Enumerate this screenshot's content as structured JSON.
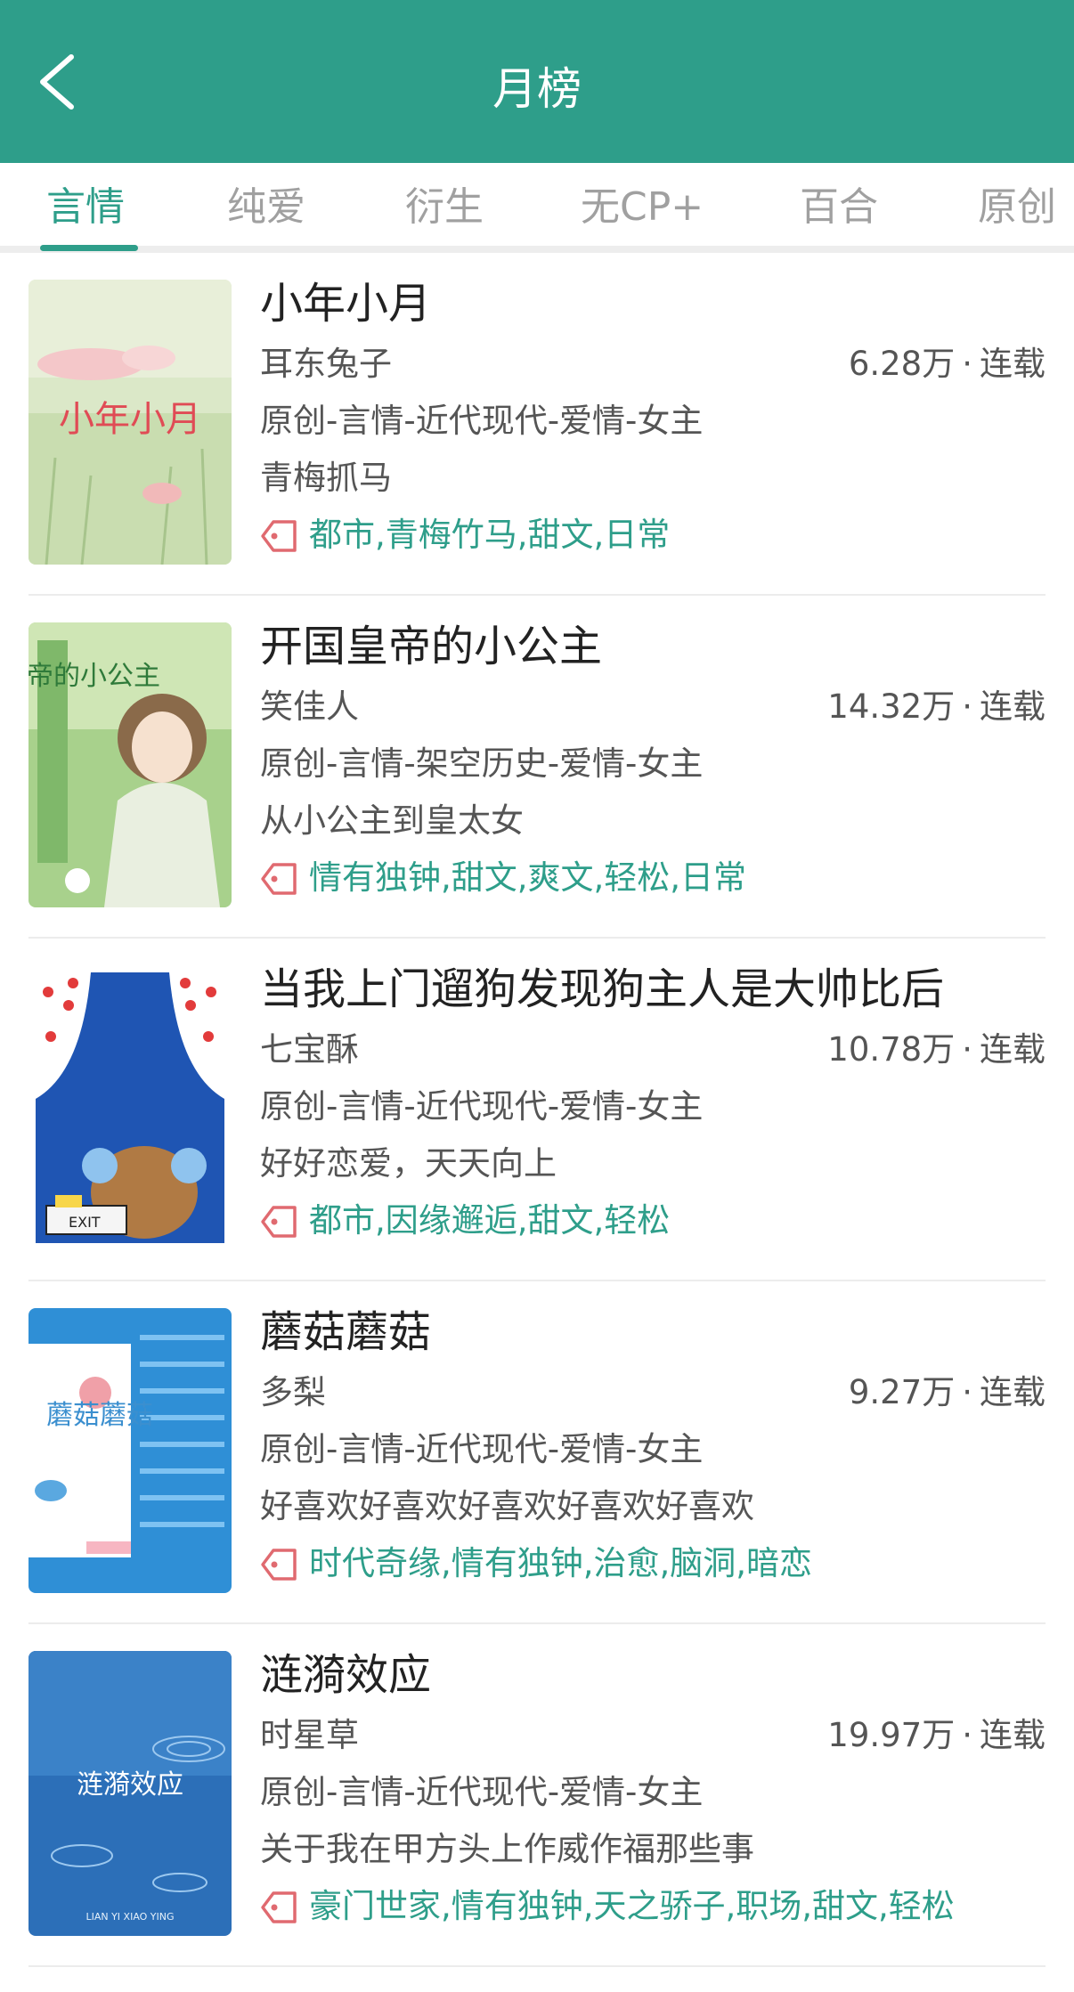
{
  "header": {
    "title": "月榜",
    "back_icon": "chevron-left-icon",
    "background": "#2e9e8a"
  },
  "tabs": [
    {
      "label": "言情",
      "active": true
    },
    {
      "label": "纯爱",
      "active": false
    },
    {
      "label": "衍生",
      "active": false
    },
    {
      "label": "无CP+",
      "active": false
    },
    {
      "label": "百合",
      "active": false
    },
    {
      "label": "原创",
      "active": false
    }
  ],
  "books": [
    {
      "title": "小年小月",
      "author": "耳东兔子",
      "count": "6.28万",
      "status": "连载",
      "category": "原创-言情-近代现代-爱情-女主",
      "intro": "青梅抓马",
      "tags": "都市,青梅竹马,甜文,日常"
    },
    {
      "title": "开国皇帝的小公主",
      "author": "笑佳人",
      "count": "14.32万",
      "status": "连载",
      "category": "原创-言情-架空历史-爱情-女主",
      "intro": "从小公主到皇太女",
      "tags": "情有独钟,甜文,爽文,轻松,日常"
    },
    {
      "title": "当我上门遛狗发现狗主人是大帅比后",
      "author": "七宝酥",
      "count": "10.78万",
      "status": "连载",
      "category": "原创-言情-近代现代-爱情-女主",
      "intro": "好好恋爱，天天向上",
      "tags": "都市,因缘邂逅,甜文,轻松"
    },
    {
      "title": "蘑菇蘑菇",
      "author": "多梨",
      "count": "9.27万",
      "status": "连载",
      "category": "原创-言情-近代现代-爱情-女主",
      "intro": "好喜欢好喜欢好喜欢好喜欢好喜欢",
      "tags": "时代奇缘,情有独钟,治愈,脑洞,暗恋"
    },
    {
      "title": "涟漪效应",
      "author": "时星草",
      "count": "19.97万",
      "status": "连载",
      "category": "原创-言情-近代现代-爱情-女主",
      "intro": "关于我在甲方头上作威作福那些事",
      "tags": "豪门世家,情有独钟,天之骄子,职场,甜文,轻松"
    }
  ],
  "covers": {
    "c1": {
      "text": "小年小月"
    },
    "c2": {
      "text": "开国皇帝的小公主"
    },
    "c3": {
      "text": "EXIT"
    },
    "c4": {
      "text": "蘑菇蘑菇"
    },
    "c5": {
      "text": "涟漪效应",
      "subtitle": "LIAN YI XIAO YING"
    }
  },
  "colors": {
    "accent": "#2e9e8a",
    "tag_icon": "#e06a70"
  },
  "separator": "·"
}
